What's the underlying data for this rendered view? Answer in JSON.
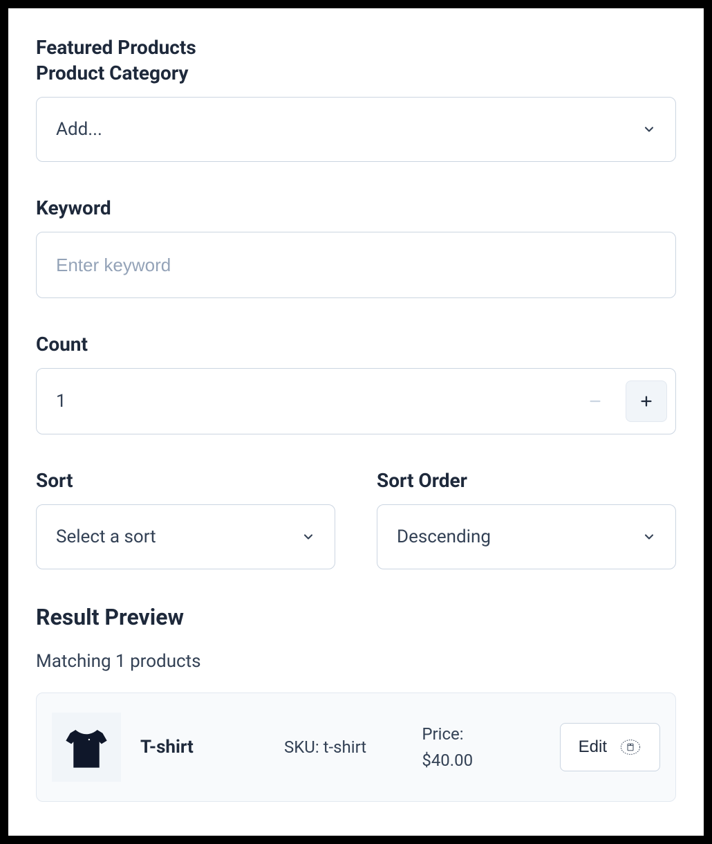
{
  "header": {
    "title": "Featured Products"
  },
  "category": {
    "label": "Product Category",
    "placeholder": "Add..."
  },
  "keyword": {
    "label": "Keyword",
    "placeholder": "Enter keyword"
  },
  "count": {
    "label": "Count",
    "value": "1"
  },
  "sort": {
    "label": "Sort",
    "placeholder": "Select a sort"
  },
  "sortOrder": {
    "label": "Sort Order",
    "value": "Descending"
  },
  "result": {
    "heading": "Result Preview",
    "matching": "Matching 1 products",
    "product": {
      "name": "T-shirt",
      "sku_label": "SKU: ",
      "sku": "t-shirt",
      "price_label": "Price: ",
      "price": "$40.00",
      "edit_label": "Edit"
    }
  }
}
